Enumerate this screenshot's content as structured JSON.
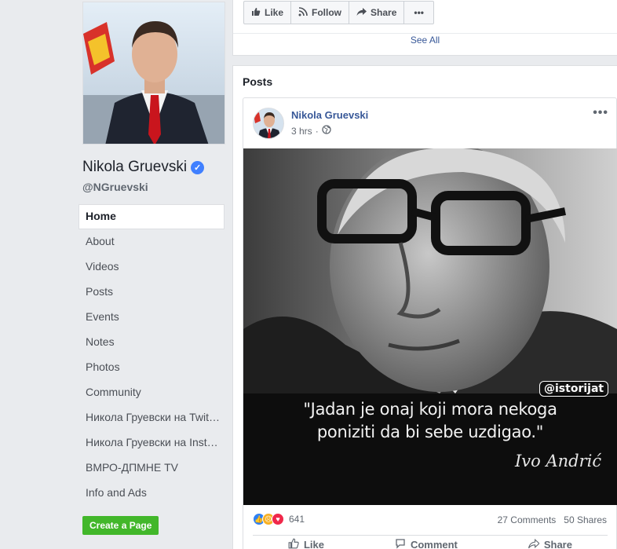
{
  "page": {
    "name": "Nikola Gruevski",
    "handle": "@NGruevski"
  },
  "nav": [
    {
      "label": "Home"
    },
    {
      "label": "About"
    },
    {
      "label": "Videos"
    },
    {
      "label": "Posts"
    },
    {
      "label": "Events"
    },
    {
      "label": "Notes"
    },
    {
      "label": "Photos"
    },
    {
      "label": "Community"
    },
    {
      "label": "Никола Груевски на Twit…"
    },
    {
      "label": "Никола Груевски на Inst…"
    },
    {
      "label": "ВМРО-ДПМНЕ TV"
    },
    {
      "label": "Info and Ads"
    }
  ],
  "create_page_label": "Create a Page",
  "action_bar": {
    "like": "Like",
    "follow": "Follow",
    "share": "Share",
    "more": "•••"
  },
  "see_all": "See All",
  "posts": {
    "title": "Posts",
    "post": {
      "author": "Nikola Gruevski",
      "time": "3 hrs",
      "more": "•••",
      "image": {
        "quote_line1": "\"Jadan je onaj koji mora nekoga",
        "quote_line2": "poniziti da bi sebe uzdigao.\"",
        "signature": "Ivo Andrić",
        "watermark": "@istorijat"
      },
      "reactions_count": "641",
      "comments": "27 Comments",
      "shares": "50 Shares",
      "actions": {
        "like": "Like",
        "comment": "Comment",
        "share": "Share"
      }
    }
  },
  "colors": {
    "link": "#385898",
    "accent_green": "#42b72a",
    "verified": "#4080ff",
    "background": "#e9ebee"
  }
}
